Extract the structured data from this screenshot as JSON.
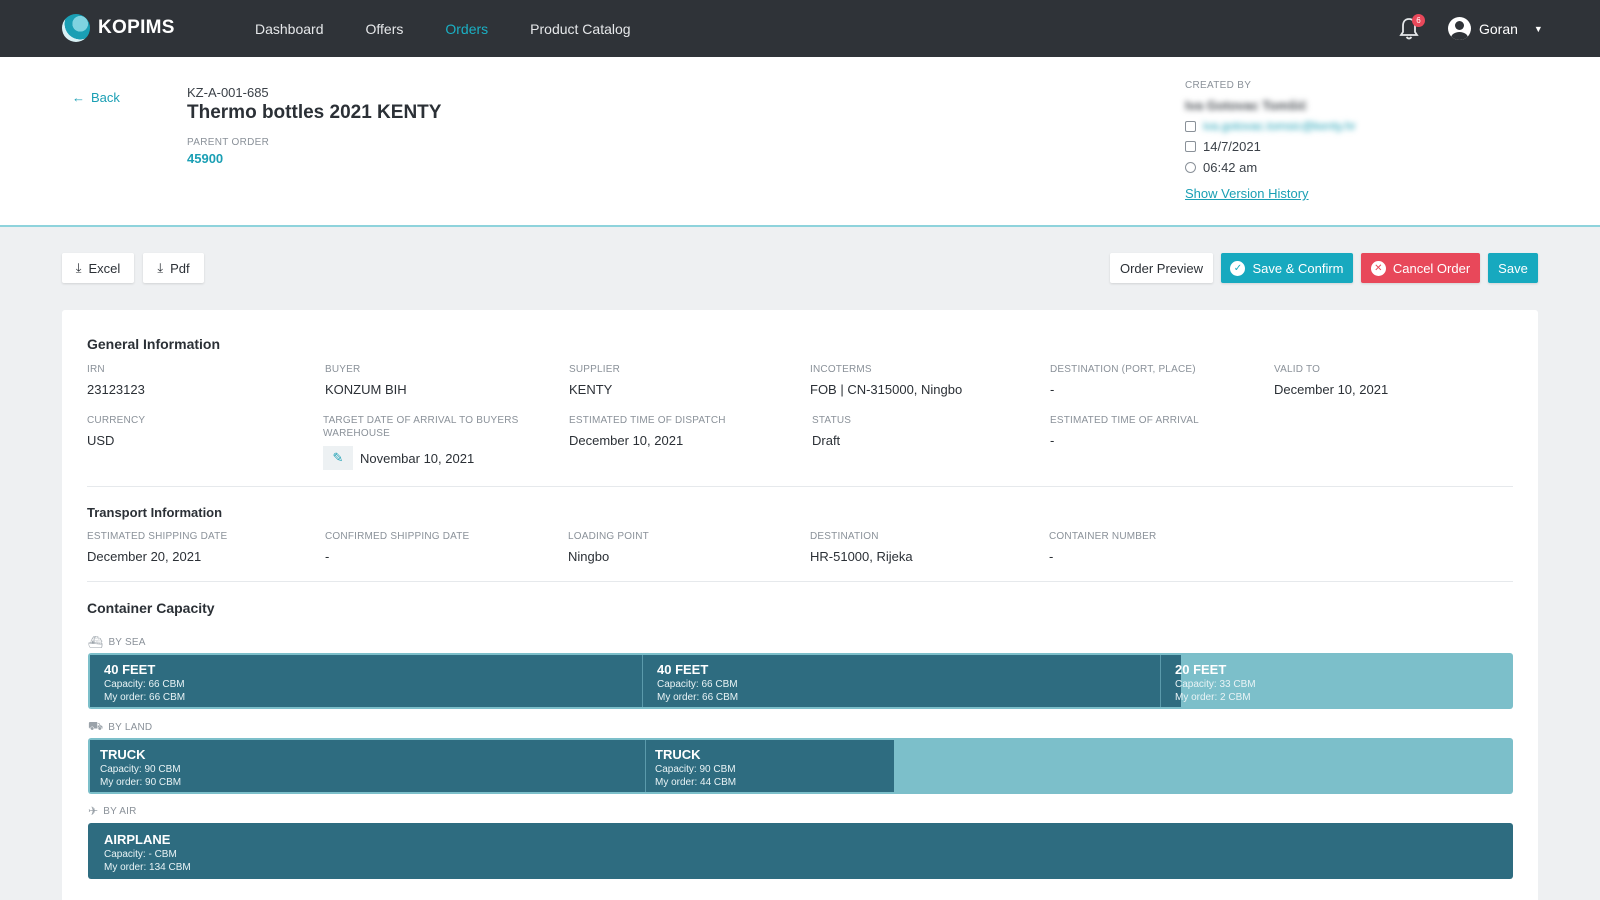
{
  "nav": {
    "brand": "KOPIMS",
    "links": [
      "Dashboard",
      "Offers",
      "Orders",
      "Product Catalog"
    ],
    "notification_count": "6",
    "user_name": "Goran"
  },
  "header": {
    "back_label": "Back",
    "order_code": "KZ-A-001-685",
    "order_title": "Thermo bottles 2021 KENTY",
    "parent_label": "PARENT ORDER",
    "parent_value": "45900",
    "created_label": "CREATED BY",
    "created_name": "Iva Gotovac Tomšić",
    "created_email": "iva.gotovac.tomsic@kenty.hr",
    "created_date": "14/7/2021",
    "created_time": "06:42 am",
    "version_link": "Show Version History"
  },
  "actions": {
    "excel": "Excel",
    "pdf": "Pdf",
    "preview": "Order Preview",
    "save_confirm": "Save & Confirm",
    "cancel_order": "Cancel Order",
    "save": "Save"
  },
  "general": {
    "title": "General Information",
    "irn_label": "IRN",
    "irn": "23123123",
    "buyer_label": "BUYER",
    "buyer": "KONZUM BIH",
    "supplier_label": "SUPPLIER",
    "supplier": "KENTY",
    "incoterms_label": "INCOTERMS",
    "incoterms": "FOB | CN-315000, Ningbo",
    "destination_label": "DESTINATION (PORT, PLACE)",
    "destination": "-",
    "valid_to_label": "VALID TO",
    "valid_to": "December 10, 2021",
    "currency_label": "CURRENCY",
    "currency": "USD",
    "target_label": "TARGET DATE OF ARRIVAL TO BUYERS WAREHOUSE",
    "target": "Novembar 10, 2021",
    "etd_label": "ESTIMATED TIME OF DISPATCH",
    "etd": "December 10, 2021",
    "status_label": "STATUS",
    "status": "Draft",
    "eta_label": "ESTIMATED TIME OF ARRIVAL",
    "eta": "-"
  },
  "transport": {
    "title": "Transport Information",
    "esd_label": "ESTIMATED SHIPPING DATE",
    "esd": "December 20, 2021",
    "csd_label": "CONFIRMED SHIPPING DATE",
    "csd": "-",
    "loading_label": "LOADING POINT",
    "loading": "Ningbo",
    "dest_label": "DESTINATION",
    "dest": "HR-51000, Rijeka",
    "container_label": "CONTAINER NUMBER",
    "container": "-"
  },
  "capacity": {
    "title": "Container Capacity",
    "sea_label": "BY SEA",
    "land_label": "BY LAND",
    "air_label": "BY AIR",
    "sea": [
      {
        "title": "40 FEET",
        "capacity": "Capacity: 66 CBM",
        "my_order": "My order: 66 CBM",
        "fill": 1.0
      },
      {
        "title": "40 FEET",
        "capacity": "Capacity: 66 CBM",
        "my_order": "My order: 66 CBM",
        "fill": 1.0
      },
      {
        "title": "20 FEET",
        "capacity": "Capacity: 33 CBM",
        "my_order": "My order: 2 CBM",
        "fill": 0.06
      }
    ],
    "land": [
      {
        "title": "TRUCK",
        "capacity": "Capacity: 90 CBM",
        "my_order": "My order: 90 CBM",
        "fill": 1.0
      },
      {
        "title": "TRUCK",
        "capacity": "Capacity: 90 CBM",
        "my_order": "My order: 44 CBM",
        "fill": 0.49
      }
    ],
    "air": [
      {
        "title": "AIRPLANE",
        "capacity": "Capacity: - CBM",
        "my_order": "My order: 134 CBM",
        "fill": 1.0
      }
    ]
  },
  "colors": {
    "nav_bg": "#2f3338",
    "accent": "#17a9bf",
    "danger": "#e8485a",
    "container_fill": "#2e6c80",
    "container_empty": "#7cbfca"
  }
}
